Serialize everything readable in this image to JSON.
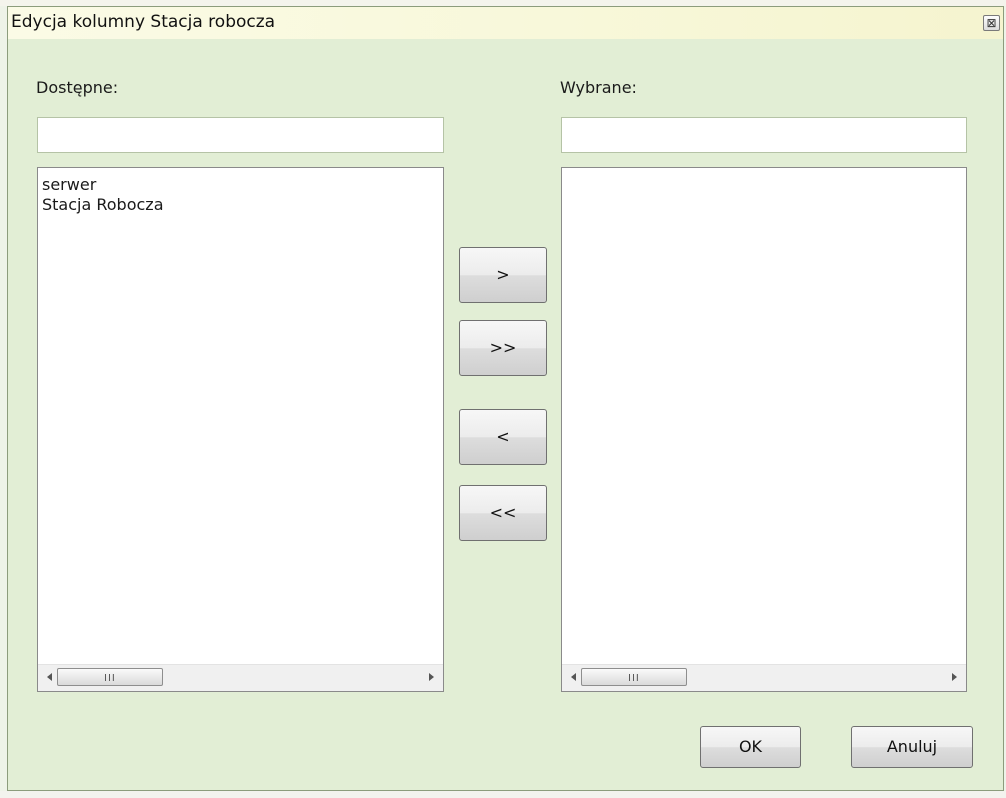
{
  "dialog": {
    "title": "Edycja kolumny Stacja robocza",
    "close_icon": "close-icon"
  },
  "available": {
    "label": "Dostępne:",
    "filter_value": "",
    "items": [
      "serwer",
      "Stacja Robocza"
    ]
  },
  "selected": {
    "label": "Wybrane:",
    "filter_value": "",
    "items": []
  },
  "buttons": {
    "add": ">",
    "add_all": ">>",
    "remove": "<",
    "remove_all": "<<",
    "ok": "OK",
    "cancel": "Anuluj"
  },
  "scrollbar": {
    "grip": "III"
  }
}
